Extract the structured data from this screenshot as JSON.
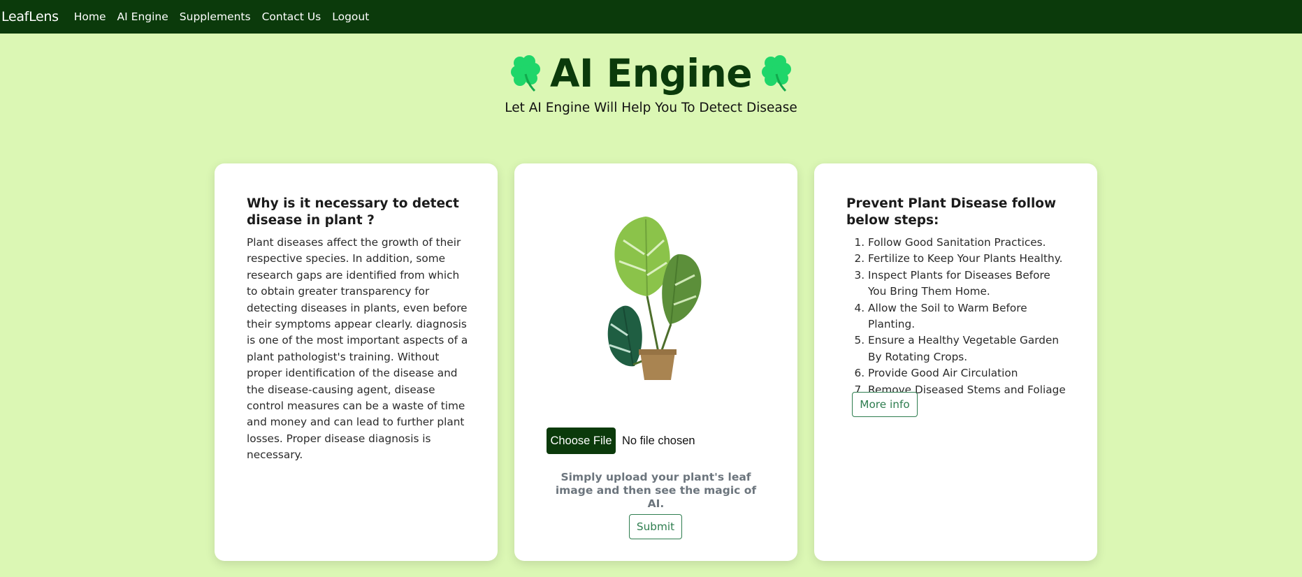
{
  "nav": {
    "brand": "LeafLens",
    "links": [
      "Home",
      "AI Engine",
      "Supplements",
      "Contact Us",
      "Logout"
    ]
  },
  "hero": {
    "title": "AI Engine",
    "subtitle": "Let AI Engine Will Help You To Detect Disease"
  },
  "left_card": {
    "title": "Why is it necessary to detect disease in plant ?",
    "text": "Plant diseases affect the growth of their respective species. In addition, some research gaps are identified from which to obtain greater transparency for detecting diseases in plants, even before their symptoms appear clearly. diagnosis is one of the most important aspects of a plant pathologist's training. Without proper identification of the disease and the disease-causing agent, disease control measures can be a waste of time and money and can lead to further plant losses. Proper disease diagnosis is necessary."
  },
  "upload_card": {
    "file_button": "Choose File",
    "file_status": "No file chosen",
    "hint": "Simply upload your plant's leaf image and then see the magic of AI.",
    "submit_label": "Submit"
  },
  "right_card": {
    "title": "Prevent Plant Disease follow below steps:",
    "steps": [
      "Follow Good Sanitation Practices.",
      "Fertilize to Keep Your Plants Healthy.",
      "Inspect Plants for Diseases Before You Bring Them Home.",
      "Allow the Soil to Warm Before Planting.",
      "Ensure a Healthy Vegetable Garden By Rotating Crops.",
      "Provide Good Air Circulation",
      "Remove Diseased Stems and Foliage"
    ],
    "more_info_label": "More info"
  },
  "colors": {
    "background": "#dbf7b4",
    "navbar": "#0b3a0b",
    "accent": "#2e7d4f",
    "clover": "#1fd66a"
  },
  "icons": [
    "four-leaf-clover-icon",
    "plant-illustration"
  ]
}
